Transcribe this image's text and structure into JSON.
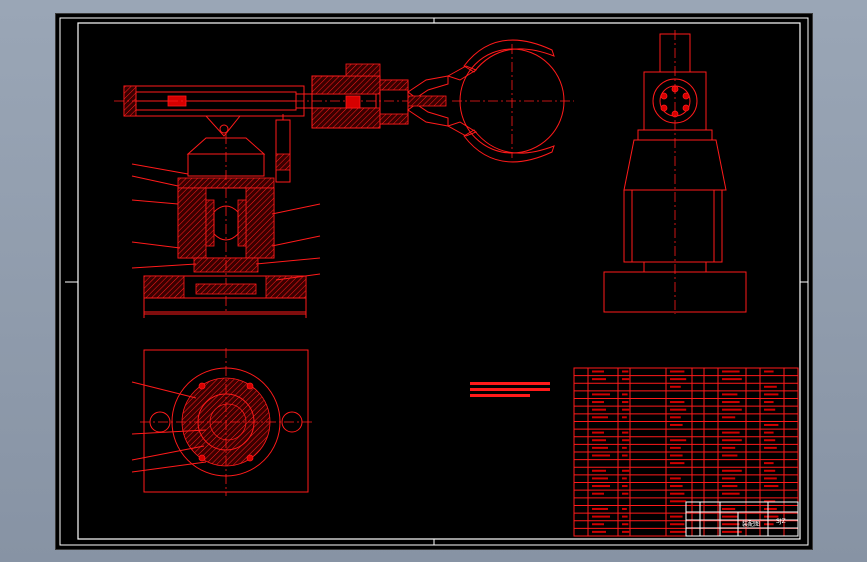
{
  "title_block": {
    "label": "装配图",
    "drawing_no": "SJZ"
  },
  "colors": {
    "sheet_background": "#000000",
    "line_color": "#ff1a1a",
    "frame_color": "#ffffff",
    "window_background": "#8d99aa"
  }
}
